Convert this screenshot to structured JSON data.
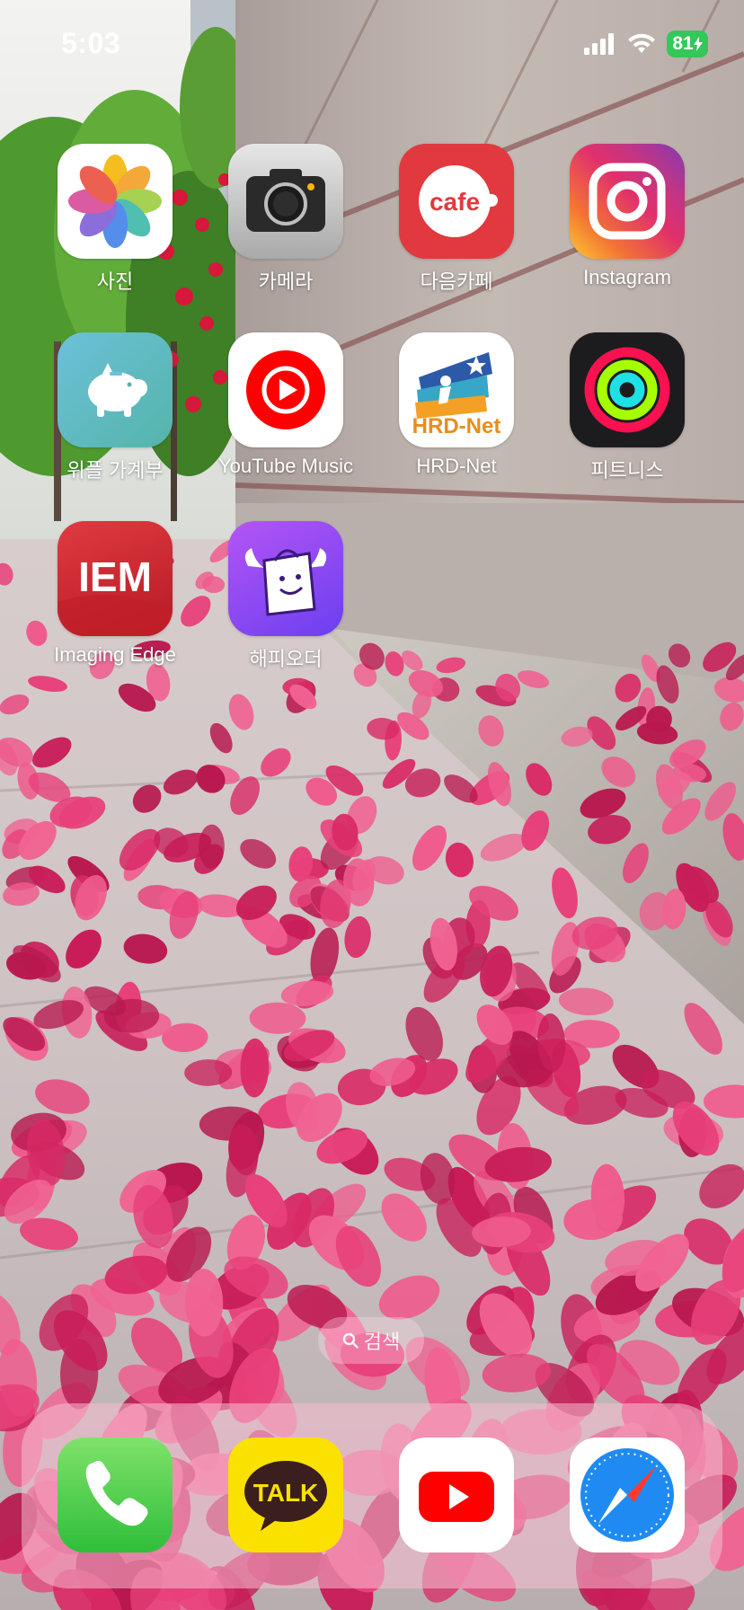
{
  "status_bar": {
    "time": "5:03",
    "battery": "81",
    "icons": [
      "signal-icon",
      "wifi-icon",
      "charging-battery-icon"
    ]
  },
  "apps": [
    {
      "label": "사진",
      "icon": "photos-icon"
    },
    {
      "label": "카메라",
      "icon": "camera-icon"
    },
    {
      "label": "다음카페",
      "icon": "daum-cafe-icon",
      "icon_text": "cafe"
    },
    {
      "label": "Instagram",
      "icon": "instagram-icon"
    },
    {
      "label": "위플 가계부",
      "icon": "piggy-bank-icon"
    },
    {
      "label": "YouTube Music",
      "icon": "youtube-music-icon"
    },
    {
      "label": "HRD-Net",
      "icon": "hrd-net-icon",
      "icon_text": "HRD-Net"
    },
    {
      "label": "피트니스",
      "icon": "fitness-rings-icon"
    },
    {
      "label": "Imaging Edge",
      "icon": "imaging-edge-icon",
      "icon_text": "IEM"
    },
    {
      "label": "해피오더",
      "icon": "happy-order-icon"
    }
  ],
  "search": {
    "label": "검색",
    "icon": "search-icon"
  },
  "dock": [
    {
      "name": "phone",
      "icon": "phone-icon"
    },
    {
      "name": "kakaotalk",
      "icon": "kakaotalk-icon",
      "icon_text": "TALK"
    },
    {
      "name": "youtube",
      "icon": "youtube-icon"
    },
    {
      "name": "safari",
      "icon": "safari-compass-icon"
    }
  ],
  "colors": {
    "battery_green": "#34c759",
    "cafe_red": "#e1393f",
    "petal_pink": "#e8407a",
    "kakao_yellow": "#fae100",
    "youtube_red": "#ff0000",
    "iem_red": "#d3242d",
    "happy_order_purple": "#7b3ff2"
  }
}
